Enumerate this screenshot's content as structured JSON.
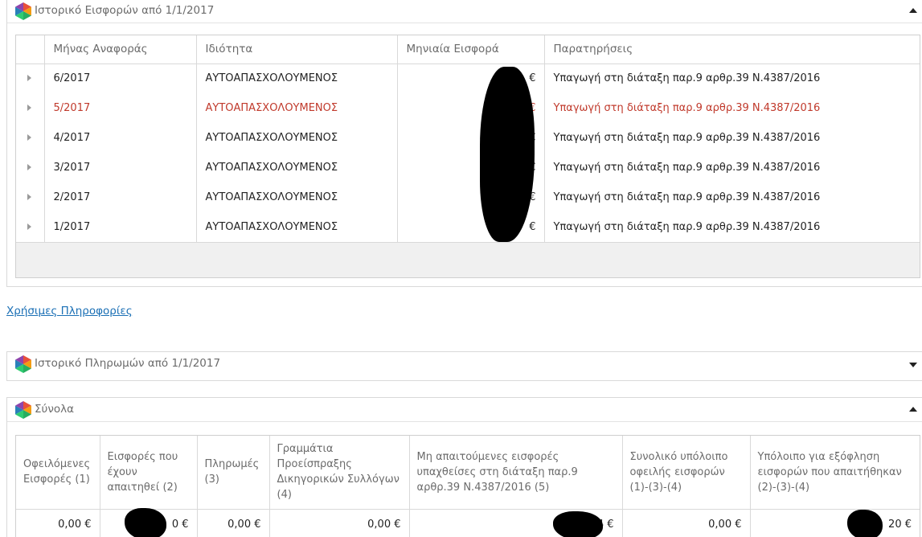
{
  "contributions": {
    "title": "Ιστορικό Εισφορών από 1/1/2017",
    "columns": [
      "",
      "Μήνας Αναφοράς",
      "Ιδιότητα",
      "Μηνιαία Εισφορά",
      "Παρατηρήσεις"
    ],
    "rows": [
      {
        "month": "6/2017",
        "role": "ΑΥΤΟΑΠΑΣΧΟΛΟΥΜΕΝΟΣ",
        "amount": "€",
        "note": "Υπαγωγή στη διάταξη παρ.9 αρθρ.39 Ν.4387/2016"
      },
      {
        "month": "5/2017",
        "role": "ΑΥΤΟΑΠΑΣΧΟΛΟΥΜΕΝΟΣ",
        "amount": "€",
        "note": "Υπαγωγή στη διάταξη παρ.9 αρθρ.39 Ν.4387/2016"
      },
      {
        "month": "4/2017",
        "role": "ΑΥΤΟΑΠΑΣΧΟΛΟΥΜΕΝΟΣ",
        "amount": "€",
        "note": "Υπαγωγή στη διάταξη παρ.9 αρθρ.39 Ν.4387/2016"
      },
      {
        "month": "3/2017",
        "role": "ΑΥΤΟΑΠΑΣΧΟΛΟΥΜΕΝΟΣ",
        "amount": "€",
        "note": "Υπαγωγή στη διάταξη παρ.9 αρθρ.39 Ν.4387/2016"
      },
      {
        "month": "2/2017",
        "role": "ΑΥΤΟΑΠΑΣΧΟΛΟΥΜΕΝΟΣ",
        "amount": "€",
        "note": "Υπαγωγή στη διάταξη παρ.9 αρθρ.39 Ν.4387/2016"
      },
      {
        "month": "1/2017",
        "role": "ΑΥΤΟΑΠΑΣΧΟΛΟΥΜΕΝΟΣ",
        "amount": "€",
        "note": "Υπαγωγή στη διάταξη παρ.9 αρθρ.39 Ν.4387/2016"
      }
    ],
    "alert_color": "#c0392b"
  },
  "useful_info_link": "Χρήσιμες Πληροφορίες",
  "payments": {
    "title": "Ιστορικό Πληρωμών από 1/1/2017"
  },
  "totals": {
    "title": "Σύνολα",
    "columns": [
      "Οφειλόμενες Εισφορές (1)",
      "Εισφορές που έχουν απαιτηθεί (2)",
      "Πληρωμές (3)",
      "Γραμμάτια Προείσπραξης Δικηγορικών Συλλόγων (4)",
      "Μη απαιτούμενες εισφορές υπαχθείσες στη διάταξη παρ.9 αρθρ.39 Ν.4387/2016 (5)",
      "Συνολικό υπόλοιπο οφειλής εισφορών (1)-(3)-(4)",
      "Υπόλοιπο για εξόφληση εισφορών που απαιτήθηκαν (2)-(3)-(4)"
    ],
    "values": [
      "0,00 €",
      "0 €",
      "0,00 €",
      "0,00 €",
      "4 €",
      "0,00 €",
      "20 €"
    ]
  },
  "icons": {
    "panel_icon": "hexagon-logo-icon",
    "collapse": "caret-up-icon",
    "expand": "caret-down-icon",
    "row_expand": "triangle-right-icon"
  }
}
